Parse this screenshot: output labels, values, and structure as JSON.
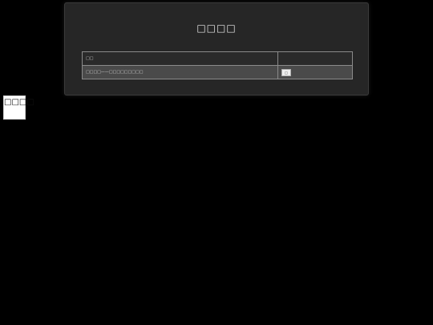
{
  "dialog": {
    "title": "□□□□"
  },
  "table": {
    "header": {
      "col1": "□□",
      "col2": ""
    },
    "rows": [
      {
        "col1": "□□□□——□□□□□□□□□",
        "action_label": "□"
      }
    ]
  },
  "floating_button": {
    "label": "□□□□"
  },
  "colors": {
    "page_background": "#000000",
    "panel_background": "#262626",
    "row_highlight": "#4a4a4a",
    "border": "#8a8a8a"
  }
}
